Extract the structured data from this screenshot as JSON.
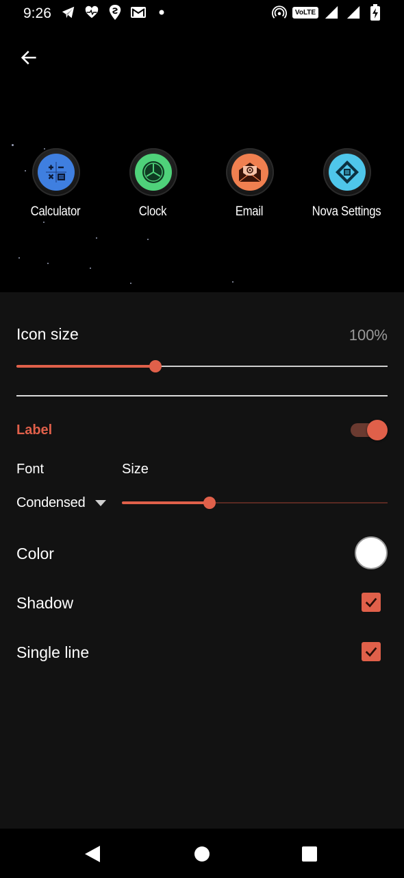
{
  "status_bar": {
    "time": "9:26",
    "left_icons": [
      "telegram-icon",
      "heart-monitor-icon",
      "swiggy-icon",
      "gmail-icon",
      "dot-icon"
    ],
    "right_icons": [
      "hotspot-icon",
      "volte-icon",
      "signal-icon",
      "signal-icon",
      "battery-charging-icon"
    ],
    "volte_text": "VoLTE"
  },
  "preview": {
    "apps": [
      {
        "label": "Calculator",
        "icon": "calculator-icon",
        "color": "#3f7fe0"
      },
      {
        "label": "Clock",
        "icon": "clock-icon",
        "color": "#4fd27a"
      },
      {
        "label": "Email",
        "icon": "email-icon",
        "color": "#f08050"
      },
      {
        "label": "Nova Settings",
        "icon": "nova-settings-icon",
        "color": "#4fc6ea"
      }
    ]
  },
  "settings": {
    "icon_size": {
      "title": "Icon size",
      "value": "100%",
      "slider_fraction": 0.375
    },
    "label_section": {
      "title": "Label",
      "enabled": true
    },
    "font": {
      "label": "Font",
      "value": "Condensed"
    },
    "size": {
      "label": "Size",
      "slider_fraction": 0.33
    },
    "color": {
      "label": "Color",
      "value_color": "#ffffff"
    },
    "shadow": {
      "label": "Shadow",
      "checked": true
    },
    "single_line": {
      "label": "Single line",
      "checked": true
    }
  },
  "colors": {
    "accent": "#e0604a",
    "background": "#121212"
  }
}
